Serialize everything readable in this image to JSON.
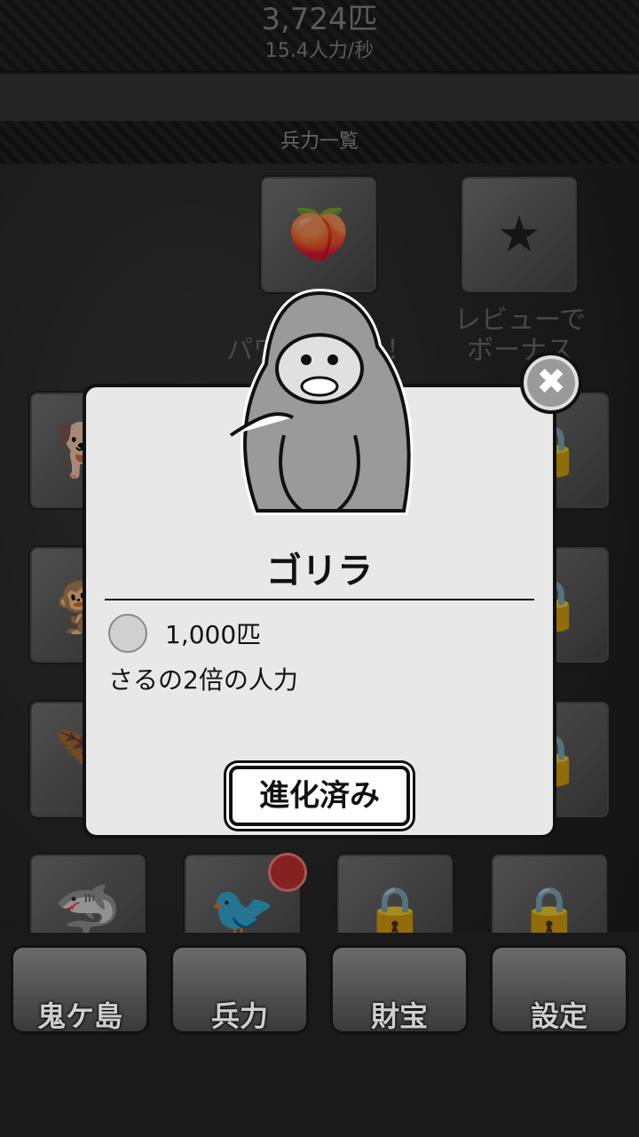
{
  "header": {
    "count": "3,724匹",
    "rate": "15.4人力/秒"
  },
  "section_title": "兵力一覧",
  "promos": [
    {
      "label": "シェア\nパワーアップ！",
      "visible": "シェ  パワ      ！"
    },
    {
      "label": "レビューで\nボーナス",
      "visible": "レビューで\nボーナス"
    }
  ],
  "modal": {
    "unit_name": "ゴリラ",
    "cost": "1,000匹",
    "description": "さるの2倍の人力",
    "button": "進化済み",
    "close": "✖"
  },
  "nav": [
    {
      "label": "鬼ケ島"
    },
    {
      "label": "兵力"
    },
    {
      "label": "財宝"
    },
    {
      "label": "設定"
    }
  ],
  "icons": {
    "locked": "lock-icon",
    "close": "close-icon",
    "unit": "gorilla-icon",
    "cost": "monkey-face-icon"
  }
}
